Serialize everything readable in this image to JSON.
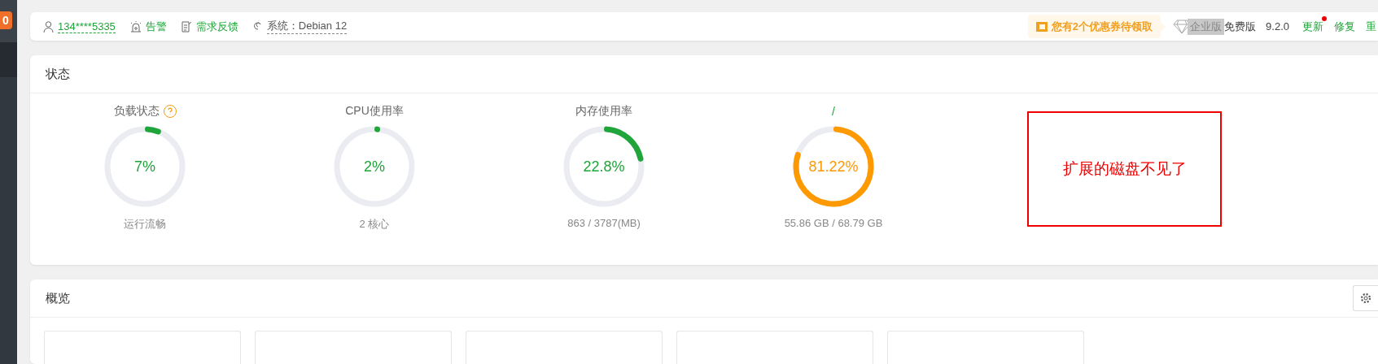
{
  "sidebar": {
    "badge": "0"
  },
  "top_bar": {
    "user": "134****5335",
    "links": [
      {
        "kind": "alarm",
        "label": "告警"
      },
      {
        "kind": "feedback",
        "label": "需求反馈"
      }
    ],
    "system": "系统：Debian 12",
    "coupon": "您有2个优惠券待领取",
    "enterprise_badge": "企业版",
    "edition": "免费版",
    "version": "9.2.0",
    "actions": [
      {
        "label": "更新",
        "dot": true
      },
      {
        "label": "修复",
        "dot": false
      },
      {
        "label": "重",
        "dot": false
      }
    ]
  },
  "status": {
    "title": "状态",
    "gauges": [
      {
        "title": "负载状态",
        "help": true,
        "value": "7%",
        "level": 0.07,
        "color": "#20a53a",
        "caption": "运行流畅"
      },
      {
        "title": "CPU使用率",
        "help": false,
        "value": "2%",
        "level": 0.02,
        "color": "#20a53a",
        "caption": "2 核心"
      },
      {
        "title": "内存使用率",
        "help": false,
        "value": "22.8%",
        "level": 0.228,
        "color": "#20a53a",
        "caption": "863 / 3787(MB)"
      },
      {
        "title": "/",
        "help": false,
        "value": "81.22%",
        "level": 0.8122,
        "color": "#ff9900",
        "caption": "55.86 GB / 68.79 GB"
      }
    ],
    "note": "扩展的磁盘不见了"
  },
  "overview": {
    "title": "概览",
    "tiles": [
      {
        "kind": "tile"
      },
      {
        "kind": "tile"
      },
      {
        "kind": "tile"
      },
      {
        "kind": "tile"
      },
      {
        "kind": "tile"
      }
    ]
  }
}
